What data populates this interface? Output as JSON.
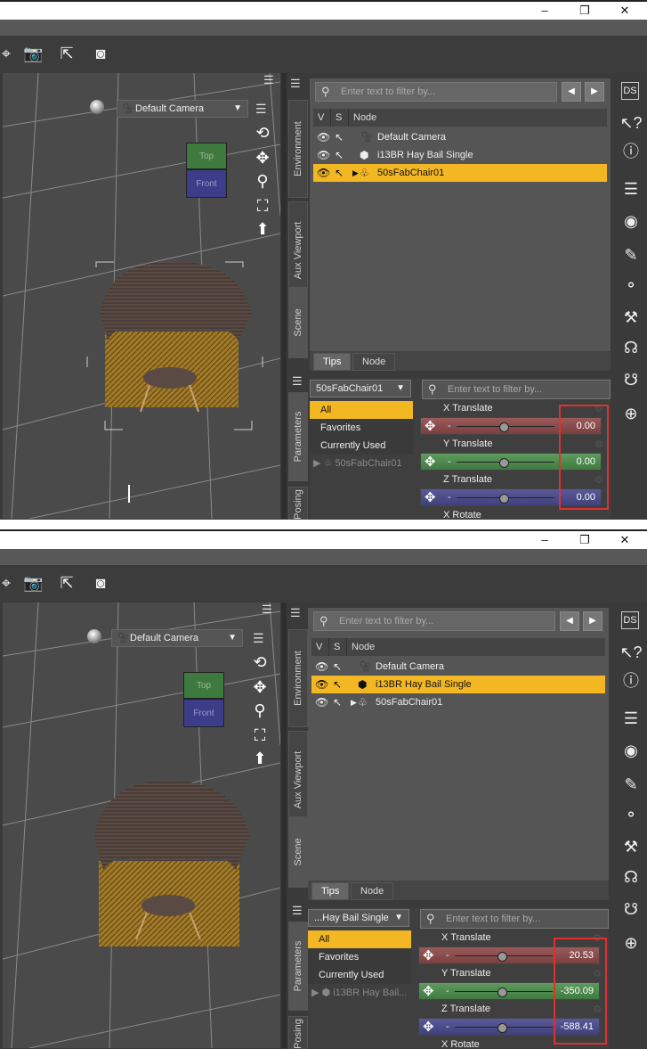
{
  "window_controls": {
    "minimize": "–",
    "maximize": "❐",
    "close": "✕"
  },
  "screens": [
    {
      "viewport": {
        "camera": "Default Camera",
        "cube_top": "Top",
        "cube_front": "Front"
      },
      "side_tabs": {
        "environment": "Environment",
        "aux_viewport": "Aux Viewport",
        "scene": "Scene",
        "parameters": "Parameters",
        "posing": "Posing"
      },
      "scene": {
        "filter_placeholder": "Enter text to filter by...",
        "columns": {
          "v": "V",
          "s": "S",
          "node": "Node"
        },
        "nodes": [
          "Default Camera",
          "i13BR Hay Bail Single",
          "50sFabChair01"
        ],
        "selected_node": "50sFabChair01",
        "tabs": {
          "tips": "Tips",
          "node": "Node"
        }
      },
      "parameters": {
        "node_select": "50sFabChair01",
        "filter_placeholder": "Enter text to filter by...",
        "groups": [
          "All",
          "Favorites",
          "Currently Used"
        ],
        "tree_node": "50sFabChair01",
        "items": [
          {
            "name": "X Translate",
            "value": "0.00"
          },
          {
            "name": "Y Translate",
            "value": "0.00"
          },
          {
            "name": "Z Translate",
            "value": "0.00"
          },
          {
            "name": "X Rotate",
            "value": ""
          }
        ]
      }
    },
    {
      "viewport": {
        "camera": "Default Camera",
        "cube_top": "Top",
        "cube_front": "Front"
      },
      "side_tabs": {
        "environment": "Environment",
        "aux_viewport": "Aux Viewport",
        "scene": "Scene",
        "parameters": "Parameters",
        "posing": "Posing"
      },
      "scene": {
        "filter_placeholder": "Enter text to filter by...",
        "columns": {
          "v": "V",
          "s": "S",
          "node": "Node"
        },
        "nodes": [
          "Default Camera",
          "i13BR Hay Bail Single",
          "50sFabChair01"
        ],
        "selected_node": "i13BR Hay Bail Single",
        "tabs": {
          "tips": "Tips",
          "node": "Node"
        }
      },
      "parameters": {
        "node_select": "...Hay Bail Single",
        "filter_placeholder": "Enter text to filter by...",
        "groups": [
          "All",
          "Favorites",
          "Currently Used"
        ],
        "tree_node": "i13BR Hay Bail...",
        "items": [
          {
            "name": "X Translate",
            "value": "20.53"
          },
          {
            "name": "Y Translate",
            "value": "-350.09"
          },
          {
            "name": "Z Translate",
            "value": "-588.41"
          },
          {
            "name": "X Rotate",
            "value": ""
          }
        ]
      }
    }
  ],
  "right_toolbar_icons": [
    "ds-logo-icon",
    "help-cursor-icon",
    "help-icon",
    "panel-icon",
    "target-icon",
    "figure-tool-icon",
    "joint-tool-icon",
    "measure-tool-icon",
    "pose-tool-icon",
    "pose-tool-2-icon",
    "globe-icon"
  ]
}
